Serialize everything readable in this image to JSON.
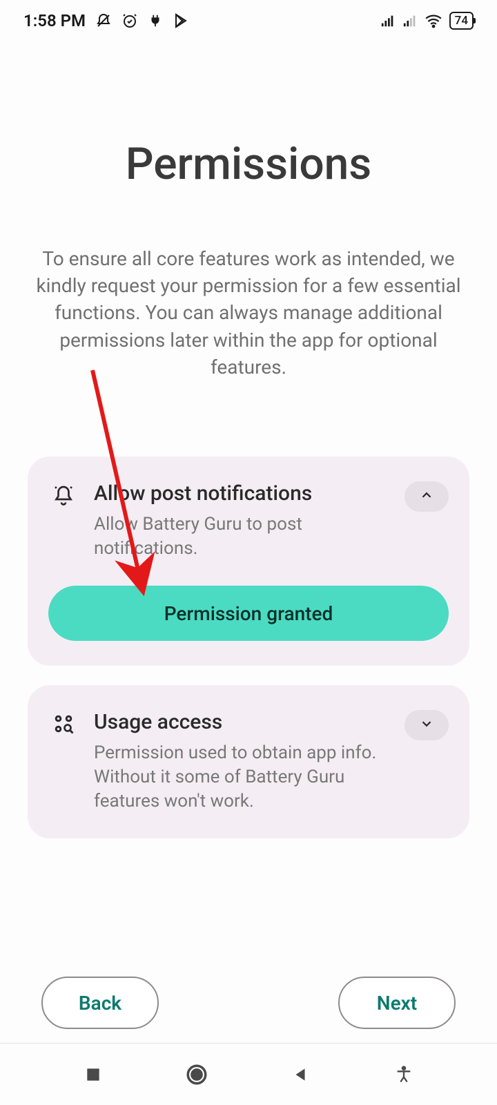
{
  "status_bar": {
    "time": "1:58 PM",
    "battery_level": "74"
  },
  "page": {
    "title": "Permissions",
    "description": "To ensure all core features work as intended, we kindly request your permission for a few essential functions. You can always manage additional permissions later within the app for optional features."
  },
  "cards": [
    {
      "title": "Allow post notifications",
      "subtitle": "Allow Battery Guru to post notifications.",
      "button_label": "Permission granted",
      "expanded": true
    },
    {
      "title": "Usage access",
      "subtitle": "Permission used to obtain app info. Without it some of Battery Guru features won't work.",
      "expanded": false
    }
  ],
  "nav": {
    "back": "Back",
    "next": "Next"
  }
}
